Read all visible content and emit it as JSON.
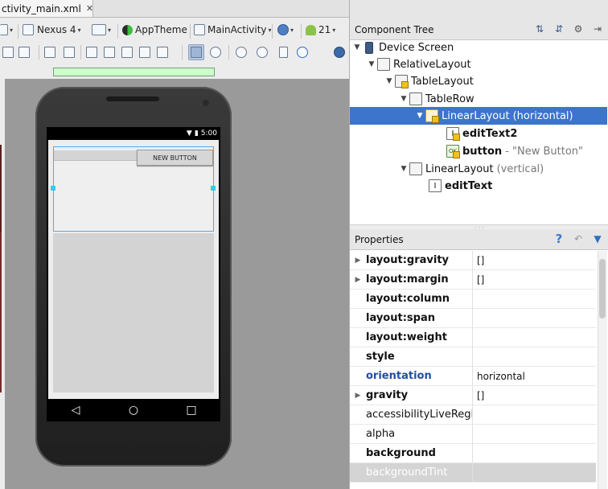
{
  "editor": {
    "file_tab": "ctivity_main.xml",
    "file_tab_close": "✕",
    "toolbar": {
      "device": "Nexus 4",
      "theme": "AppTheme",
      "activity": "MainActivity",
      "api": "21"
    },
    "preview": {
      "status_time": "5:00",
      "button_label": "NEW BUTTON"
    }
  },
  "component_tree": {
    "title": "Component Tree",
    "nodes": [
      {
        "label": "Device Screen",
        "hint": ""
      },
      {
        "label": "RelativeLayout",
        "hint": ""
      },
      {
        "label": "TableLayout",
        "hint": ""
      },
      {
        "label": "TableRow",
        "hint": ""
      },
      {
        "label": "LinearLayout",
        "hint": "(horizontal)"
      },
      {
        "label": "editText2",
        "hint": ""
      },
      {
        "label": "button",
        "hint": "- \"New Button\""
      },
      {
        "label": "LinearLayout",
        "hint": "(vertical)"
      },
      {
        "label": "editText",
        "hint": ""
      }
    ]
  },
  "properties": {
    "title": "Properties",
    "rows": [
      {
        "name": "layout:gravity",
        "value": "[]"
      },
      {
        "name": "layout:margin",
        "value": "[]"
      },
      {
        "name": "layout:column",
        "value": ""
      },
      {
        "name": "layout:span",
        "value": ""
      },
      {
        "name": "layout:weight",
        "value": ""
      },
      {
        "name": "style",
        "value": ""
      },
      {
        "name": "orientation",
        "value": "horizontal"
      },
      {
        "name": "gravity",
        "value": "[]"
      },
      {
        "name": "accessibilityLiveRegion",
        "value": ""
      },
      {
        "name": "alpha",
        "value": ""
      },
      {
        "name": "background",
        "value": ""
      },
      {
        "name": "backgroundTint",
        "value": ""
      }
    ]
  },
  "colors": {
    "selection": "#3d74cc",
    "accent_blue": "#1f4fa0"
  }
}
